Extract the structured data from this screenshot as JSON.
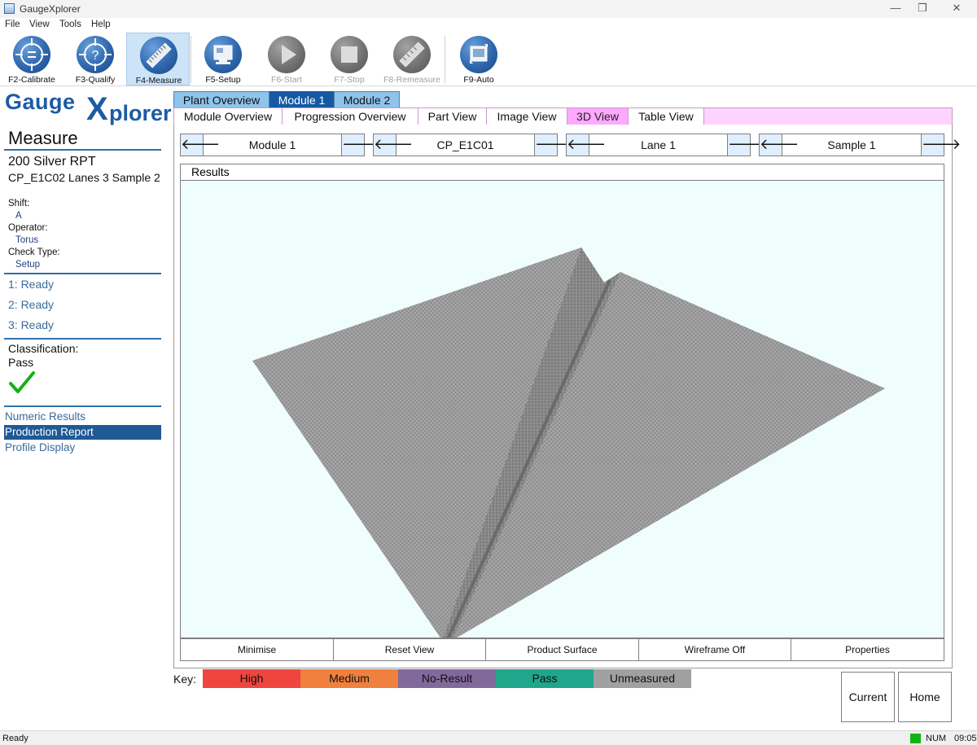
{
  "window": {
    "title": "GaugeXplorer",
    "minimize": "—",
    "restore": "❐",
    "close": "✕"
  },
  "menu": [
    "File",
    "View",
    "Tools",
    "Help"
  ],
  "toolbar": [
    {
      "label": "F2-Calibrate",
      "enabled": true,
      "active": false,
      "icon": "calibrate-icon"
    },
    {
      "label": "F3-Qualify",
      "enabled": true,
      "active": false,
      "icon": "qualify-icon"
    },
    {
      "label": "F4-Measure",
      "enabled": true,
      "active": true,
      "icon": "measure-icon"
    },
    {
      "label": "F5-Setup",
      "enabled": true,
      "active": false,
      "icon": "setup-icon"
    },
    {
      "label": "F6-Start",
      "enabled": false,
      "active": false,
      "icon": "start-icon"
    },
    {
      "label": "F7-Stop",
      "enabled": false,
      "active": false,
      "icon": "stop-icon"
    },
    {
      "label": "F8-Remeasure",
      "enabled": false,
      "active": false,
      "icon": "remeasure-icon"
    },
    {
      "label": "F9-Auto",
      "enabled": true,
      "active": false,
      "icon": "auto-icon"
    }
  ],
  "logo": {
    "part1": "Gauge",
    "part2": "X",
    "part3": "plorer"
  },
  "panel": {
    "heading": "Measure",
    "part": "200 Silver RPT",
    "subtitle": "CP_E1C02 Lanes 3 Sample 2",
    "shift_label": "Shift:",
    "shift": "A",
    "operator_label": "Operator:",
    "operator": "Torus",
    "check_label": "Check Type:",
    "check": "Setup",
    "statuses": [
      "1: Ready",
      "2: Ready",
      "3: Ready"
    ],
    "classification_label": "Classification:",
    "classification": "Pass",
    "links": [
      "Numeric Results",
      "Production Report",
      "Profile Display"
    ],
    "selected_link": "Production Report"
  },
  "tabs_top": [
    "Plant Overview",
    "Module 1",
    "Module 2"
  ],
  "tabs_top_selected": "Module 1",
  "tabs_view": [
    "Module Overview",
    "Progression Overview",
    "Part View",
    "Image View",
    "3D View",
    "Table View"
  ],
  "tabs_view_selected": "3D View",
  "selectors": [
    "Module 1",
    "CP_E1C01",
    "Lane 1",
    "Sample 1"
  ],
  "arrows": {
    "prev": "🡐",
    "next": "🡒"
  },
  "results": {
    "title": "Results"
  },
  "view_buttons": [
    "Minimise",
    "Reset View",
    "Product Surface",
    "Wireframe Off",
    "Properties"
  ],
  "key": {
    "label": "Key:",
    "items": [
      {
        "name": "High",
        "color": "#f0453f"
      },
      {
        "name": "Medium",
        "color": "#f0803d"
      },
      {
        "name": "No-Result",
        "color": "#81699c"
      },
      {
        "name": "Pass",
        "color": "#20a68a"
      },
      {
        "name": "Unmeasured",
        "color": "#a0a0a0"
      }
    ]
  },
  "buttons": {
    "current": "Current",
    "home": "Home"
  },
  "status": {
    "text": "Ready",
    "num": "NUM",
    "time": "09:05",
    "led_color": "#10b410"
  }
}
